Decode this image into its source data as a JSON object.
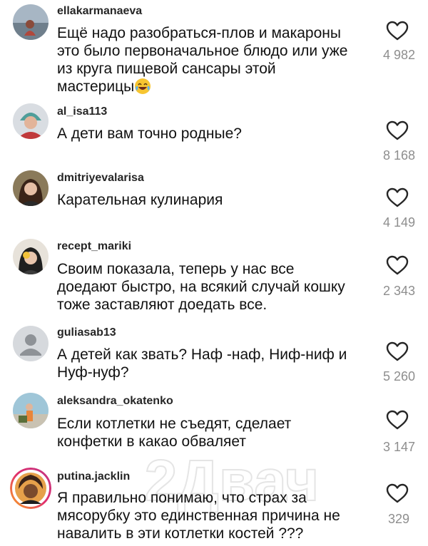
{
  "comments": [
    {
      "username": "ellakarmanaeva",
      "lines": [
        "Ещё надо разобраться-плов и макароны",
        "это было первоначальное блюдо или уже",
        "из круга пищевой сансары этой",
        "мастерицы"
      ],
      "emoji": "laughing-with-tears-emoji",
      "likes": "4 982"
    },
    {
      "username": "al_isa113",
      "lines": [
        "А дети вам точно родные?"
      ],
      "likes": "8 168"
    },
    {
      "username": "dmitriyevalarisa",
      "lines": [
        "Карательная кулинария"
      ],
      "likes": "4 149"
    },
    {
      "username": "recept_mariki",
      "lines": [
        "Своим показала, теперь у нас все",
        "доедают быстро, на всякий случай кошку",
        "тоже заставляют доедать все."
      ],
      "likes": "2 343"
    },
    {
      "username": "guliasab13",
      "lines": [
        "А детей как звать? Наф -наф, Ниф-ниф и",
        "Нуф-нуф?"
      ],
      "likes": "5 260"
    },
    {
      "username": "aleksandra_okatenko",
      "lines": [
        "Если котлетки не съедят, сделает",
        "конфетки в какао обваляет"
      ],
      "likes": "3 147"
    },
    {
      "username": "putina.jacklin",
      "lines": [
        "Я правильно понимаю, что страх за",
        "мясорубку это единственная причина не",
        "навалить в эти котлетки костей ???"
      ],
      "likes": "329"
    }
  ],
  "watermark": "2Двач",
  "colors": {
    "text": "#111111",
    "username": "#262626",
    "count": "#8e8e8e",
    "heart_outline": "#262626",
    "story_ring": "#e1306c"
  },
  "icons": {
    "like": "heart-outline-icon",
    "default_avatar": "person-silhouette-icon"
  }
}
